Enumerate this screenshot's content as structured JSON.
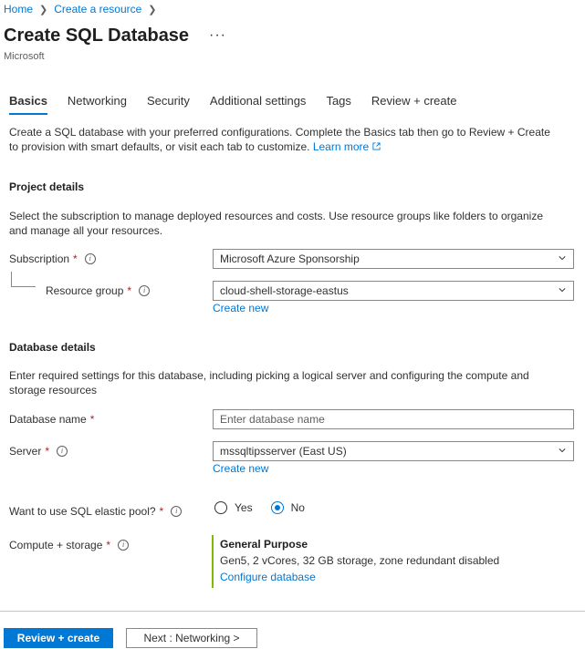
{
  "breadcrumb": {
    "home": "Home",
    "create_resource": "Create a resource"
  },
  "page": {
    "title": "Create SQL Database",
    "more": "···",
    "publisher": "Microsoft"
  },
  "tabs": [
    "Basics",
    "Networking",
    "Security",
    "Additional settings",
    "Tags",
    "Review + create"
  ],
  "intro": {
    "text": "Create a SQL database with your preferred configurations. Complete the Basics tab then go to Review + Create to provision with smart defaults, or visit each tab to customize.",
    "learn_more": "Learn more"
  },
  "project": {
    "heading": "Project details",
    "description": "Select the subscription to manage deployed resources and costs. Use resource groups like folders to organize and manage all your resources.",
    "subscription_label": "Subscription",
    "subscription_value": "Microsoft Azure Sponsorship",
    "resource_group_label": "Resource group",
    "resource_group_value": "cloud-shell-storage-eastus",
    "create_new": "Create new"
  },
  "database": {
    "heading": "Database details",
    "description": "Enter required settings for this database, including picking a logical server and configuring the compute and storage resources",
    "name_label": "Database name",
    "name_placeholder": "Enter database name",
    "server_label": "Server",
    "server_value": "mssqltipsserver (East US)",
    "create_new": "Create new",
    "elastic_label": "Want to use SQL elastic pool?",
    "elastic_yes": "Yes",
    "elastic_no": "No",
    "elastic_selected": "No",
    "compute_label": "Compute + storage",
    "compute_tier": "General Purpose",
    "compute_detail": "Gen5, 2 vCores, 32 GB storage, zone redundant disabled",
    "configure": "Configure database"
  },
  "footer": {
    "review_create": "Review + create",
    "next": "Next : Networking >"
  },
  "colors": {
    "accent": "#0078d4",
    "required": "#a4262c",
    "tier_bar": "#7fba00"
  }
}
